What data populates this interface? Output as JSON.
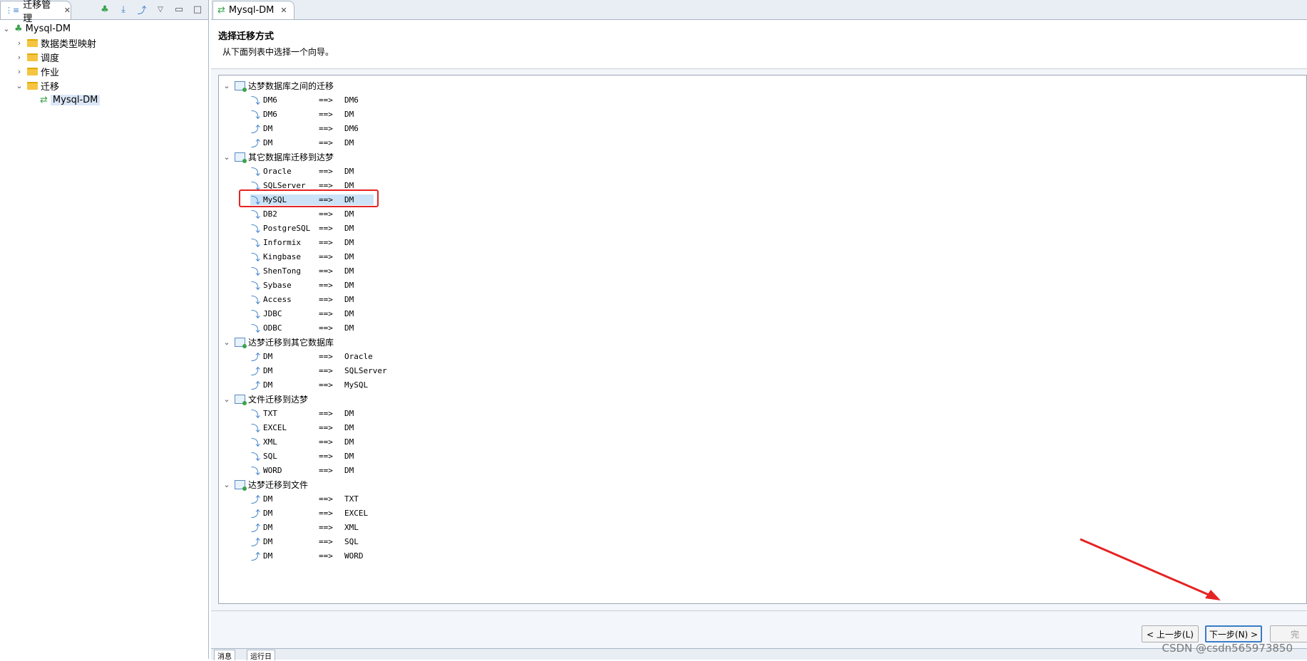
{
  "left": {
    "tab_title": "迁移管理",
    "tree": {
      "root": "Mysql-DM",
      "children": [
        "数据类型映射",
        "调度",
        "作业",
        "迁移"
      ],
      "migration_child": "Mysql-DM"
    }
  },
  "right": {
    "tab_title": "Mysql-DM",
    "title": "选择迁移方式",
    "subtitle": "从下面列表中选择一个向导。",
    "arrow_text": "==>",
    "groups": [
      {
        "label": "达梦数据库之间的迁移",
        "items": [
          [
            "DM6",
            "DM6"
          ],
          [
            "DM6",
            "DM"
          ],
          [
            "DM",
            "DM6"
          ],
          [
            "DM",
            "DM"
          ]
        ]
      },
      {
        "label": "其它数据库迁移到达梦",
        "items": [
          [
            "Oracle",
            "DM"
          ],
          [
            "SQLServer",
            "DM"
          ],
          [
            "MySQL",
            "DM"
          ],
          [
            "DB2",
            "DM"
          ],
          [
            "PostgreSQL",
            "DM"
          ],
          [
            "Informix",
            "DM"
          ],
          [
            "Kingbase",
            "DM"
          ],
          [
            "ShenTong",
            "DM"
          ],
          [
            "Sybase",
            "DM"
          ],
          [
            "Access",
            "DM"
          ],
          [
            "JDBC",
            "DM"
          ],
          [
            "ODBC",
            "DM"
          ]
        ]
      },
      {
        "label": "达梦迁移到其它数据库",
        "items": [
          [
            "DM",
            "Oracle"
          ],
          [
            "DM",
            "SQLServer"
          ],
          [
            "DM",
            "MySQL"
          ]
        ]
      },
      {
        "label": "文件迁移到达梦",
        "items": [
          [
            "TXT",
            "DM"
          ],
          [
            "EXCEL",
            "DM"
          ],
          [
            "XML",
            "DM"
          ],
          [
            "SQL",
            "DM"
          ],
          [
            "WORD",
            "DM"
          ]
        ]
      },
      {
        "label": "达梦迁移到文件",
        "items": [
          [
            "DM",
            "TXT"
          ],
          [
            "DM",
            "EXCEL"
          ],
          [
            "DM",
            "XML"
          ],
          [
            "DM",
            "SQL"
          ],
          [
            "DM",
            "WORD"
          ]
        ]
      }
    ],
    "selected": "MySQL"
  },
  "buttons": {
    "back": "< 上一步(L)",
    "next": "下一步(N) >",
    "finish_partial": "完"
  },
  "bottom_tabs": [
    "消息",
    "运行日"
  ],
  "watermark": "CSDN @csdn565973850",
  "colors": {
    "highlight": "#e52323",
    "selection": "#cce3f7",
    "accent": "#3a7cc7"
  }
}
